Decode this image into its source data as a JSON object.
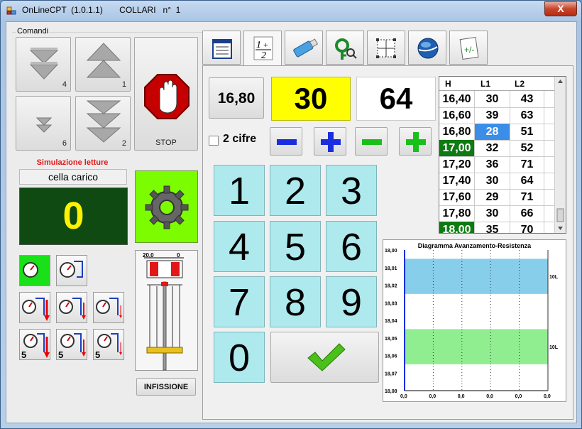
{
  "window": {
    "title": "OnLineCPT  (1.0.1.1)       COLLARI   n°  1",
    "close_glyph": "X"
  },
  "commands": {
    "group_label": "Comandi",
    "buttons": [
      {
        "name": "down-double",
        "number": "4"
      },
      {
        "name": "up-double",
        "number": "1"
      },
      {
        "name": "down-small",
        "number": "6"
      },
      {
        "name": "down-triple",
        "number": "2"
      }
    ],
    "stop_label": "STOP"
  },
  "simulation": {
    "label": "Simulazione letture",
    "sensor_name": "cella carico",
    "reading": "0"
  },
  "infissione_label": "INFISSIONE",
  "cylinder": {
    "left_label": "20,0",
    "right_label": "0"
  },
  "tabs": [
    {
      "icon": "list-form-icon"
    },
    {
      "icon": "fraction-icon",
      "active": true
    },
    {
      "icon": "usb-drive-icon"
    },
    {
      "icon": "key-search-icon"
    },
    {
      "icon": "grid-select-icon"
    },
    {
      "icon": "globe-icon"
    },
    {
      "icon": "calculator-icon"
    }
  ],
  "entry": {
    "h_value": "16,80",
    "l1_value": "30",
    "l2_value": "64",
    "two_digits_label": "2 cifre"
  },
  "keypad": {
    "keys": [
      "1",
      "2",
      "3",
      "4",
      "5",
      "6",
      "7",
      "8",
      "9",
      "0"
    ]
  },
  "readings_table": {
    "headers": [
      "H",
      "L1",
      "L2"
    ],
    "rows": [
      {
        "h": "16,40",
        "l1": "30",
        "l2": "43",
        "h_highlight": false,
        "l1_selected": false
      },
      {
        "h": "16,60",
        "l1": "39",
        "l2": "63",
        "h_highlight": false,
        "l1_selected": false
      },
      {
        "h": "16,80",
        "l1": "28",
        "l2": "51",
        "h_highlight": false,
        "l1_selected": true
      },
      {
        "h": "17,00",
        "l1": "32",
        "l2": "52",
        "h_highlight": true,
        "l1_selected": false
      },
      {
        "h": "17,20",
        "l1": "36",
        "l2": "71",
        "h_highlight": false,
        "l1_selected": false
      },
      {
        "h": "17,40",
        "l1": "30",
        "l2": "64",
        "h_highlight": false,
        "l1_selected": false
      },
      {
        "h": "17,60",
        "l1": "29",
        "l2": "71",
        "h_highlight": false,
        "l1_selected": false
      },
      {
        "h": "17,80",
        "l1": "30",
        "l2": "66",
        "h_highlight": false,
        "l1_selected": false
      },
      {
        "h": "18,00",
        "l1": "35",
        "l2": "70",
        "h_highlight": true,
        "l1_selected": false
      }
    ]
  },
  "chart_data": {
    "type": "bar",
    "title": "Diagramma Avanzamento-Resistenza",
    "y_ticks": [
      "18,00",
      "18,01",
      "18,02",
      "18,03",
      "18,04",
      "18,05",
      "18,06",
      "18,07",
      "18,08"
    ],
    "x_ticks": [
      "0,0",
      "0,0",
      "0,0",
      "0,0",
      "0,0",
      "0,0"
    ],
    "bands": [
      {
        "y_from": 18.005,
        "y_to": 18.025,
        "color": "#87ceeb",
        "label": "10L"
      },
      {
        "y_from": 18.045,
        "y_to": 18.065,
        "color": "#90ee90",
        "label": "10L"
      }
    ],
    "ylim": [
      18.0,
      18.08
    ],
    "grid": true
  }
}
